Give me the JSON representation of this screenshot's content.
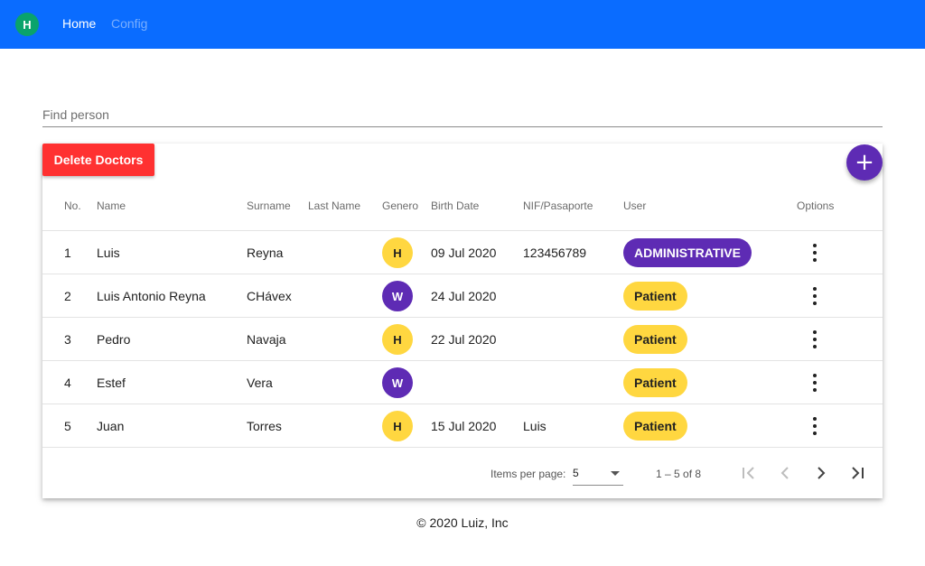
{
  "nav": {
    "logo_letter": "H",
    "home_label": "Home",
    "config_label": "Config"
  },
  "search": {
    "placeholder": "Find person",
    "value": ""
  },
  "toolbar": {
    "delete_label": "Delete Doctors",
    "add_symbol": "+"
  },
  "table": {
    "headers": {
      "no": "No.",
      "name": "Name",
      "surname": "Surname",
      "last_name": "Last Name",
      "genero": "Genero",
      "birth_date": "Birth Date",
      "nif": "NIF/Pasaporte",
      "user": "User",
      "options": "Options"
    },
    "rows": [
      {
        "no": "1",
        "name": "Luis",
        "surname": "Reyna",
        "last_name": "",
        "genero": "H",
        "birth_date": "09 Jul 2020",
        "nif": "123456789",
        "user": "ADMINISTRATIVE"
      },
      {
        "no": "2",
        "name": "Luis Antonio Reyna",
        "surname": "CHávex",
        "last_name": "",
        "genero": "W",
        "birth_date": "24 Jul 2020",
        "nif": "",
        "user": "Patient"
      },
      {
        "no": "3",
        "name": "Pedro",
        "surname": "Navaja",
        "last_name": "",
        "genero": "H",
        "birth_date": "22 Jul 2020",
        "nif": "",
        "user": "Patient"
      },
      {
        "no": "4",
        "name": "Estef",
        "surname": "Vera",
        "last_name": "",
        "genero": "W",
        "birth_date": "",
        "nif": "",
        "user": "Patient"
      },
      {
        "no": "5",
        "name": "Juan",
        "surname": "Torres",
        "last_name": "",
        "genero": "H",
        "birth_date": "15 Jul 2020",
        "nif": "Luis",
        "user": "Patient"
      }
    ]
  },
  "paginator": {
    "items_per_page_label": "Items per page:",
    "items_per_page_value": "5",
    "range_label": "1 – 5 of 8"
  },
  "footer": {
    "copyright": "© 2020 Luiz, Inc"
  },
  "colors": {
    "topbar": "#0a6cff",
    "logo": "#0aa36b",
    "delete": "#ff3131",
    "purple": "#5e2bb4",
    "yellow": "#ffd740"
  }
}
